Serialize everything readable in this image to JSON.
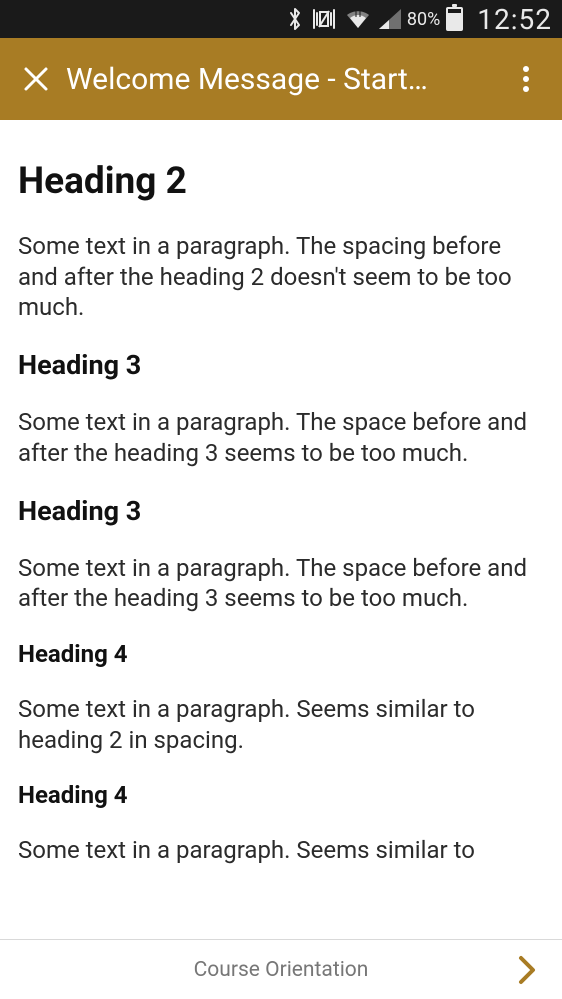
{
  "status": {
    "battery_pct": "80%",
    "clock": "12:52"
  },
  "appbar": {
    "title": "Welcome Message - Start…"
  },
  "content": {
    "blocks": [
      {
        "type": "h2",
        "text": "Heading 2"
      },
      {
        "type": "p",
        "text": "Some text in a paragraph. The spacing before and after the heading 2 doesn't seem to be too much."
      },
      {
        "type": "h3",
        "text": "Heading 3"
      },
      {
        "type": "p",
        "text": "Some text in a paragraph. The space before and after the heading 3 seems to be too much."
      },
      {
        "type": "h3",
        "text": "Heading 3"
      },
      {
        "type": "p",
        "text": "Some text in a paragraph. The space before and after the heading 3 seems to be too much."
      },
      {
        "type": "h4",
        "text": "Heading 4"
      },
      {
        "type": "p",
        "text": "Some text in a paragraph. Seems similar to heading 2 in spacing."
      },
      {
        "type": "h4",
        "text": "Heading 4"
      },
      {
        "type": "p",
        "text": "Some text in a paragraph. Seems similar to"
      }
    ]
  },
  "bottombar": {
    "label": "Course Orientation"
  }
}
